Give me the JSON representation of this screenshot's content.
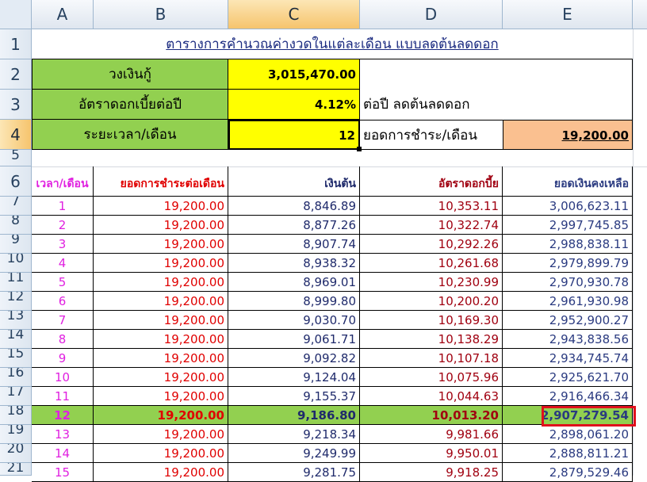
{
  "columns": [
    "A",
    "B",
    "C",
    "D",
    "E"
  ],
  "rows": [
    "1",
    "2",
    "3",
    "4",
    "5",
    "6",
    "7",
    "8",
    "9",
    "10",
    "11",
    "12",
    "13",
    "14",
    "15",
    "16",
    "17",
    "18",
    "19",
    "20",
    "21"
  ],
  "title": "ตารางการคำนวณค่างวดในแต่ละเดือน แบบลดต้นลดดอก",
  "loan_label": "วงเงินกู้",
  "loan_value": "3,015,470.00",
  "rate_label": "อัตราดอกเบี้ยต่อปี",
  "rate_value": "4.12%",
  "rate_note": "ต่อปี ลดต้นลดดอก",
  "term_label": "ระยะเวลา/เดือน",
  "term_value": "12",
  "payment_label": "ยอดการชำระ/เดือน",
  "payment_value": "19,200.00",
  "table": {
    "headers": [
      "เวลา/เดือน",
      "ยอดการชำระต่อเดือน",
      "เงินต้น",
      "อัตราดอกบี้ย",
      "ยอดเงินคงเหลือ"
    ],
    "rows": [
      [
        "1",
        "19,200.00",
        "8,846.89",
        "10,353.11",
        "3,006,623.11"
      ],
      [
        "2",
        "19,200.00",
        "8,877.26",
        "10,322.74",
        "2,997,745.85"
      ],
      [
        "3",
        "19,200.00",
        "8,907.74",
        "10,292.26",
        "2,988,838.11"
      ],
      [
        "4",
        "19,200.00",
        "8,938.32",
        "10,261.68",
        "2,979,899.79"
      ],
      [
        "5",
        "19,200.00",
        "8,969.01",
        "10,230.99",
        "2,970,930.78"
      ],
      [
        "6",
        "19,200.00",
        "8,999.80",
        "10,200.20",
        "2,961,930.98"
      ],
      [
        "7",
        "19,200.00",
        "9,030.70",
        "10,169.30",
        "2,952,900.27"
      ],
      [
        "8",
        "19,200.00",
        "9,061.71",
        "10,138.29",
        "2,943,838.56"
      ],
      [
        "9",
        "19,200.00",
        "9,092.82",
        "10,107.18",
        "2,934,745.74"
      ],
      [
        "10",
        "19,200.00",
        "9,124.04",
        "10,075.96",
        "2,925,621.70"
      ],
      [
        "11",
        "19,200.00",
        "9,155.37",
        "10,044.63",
        "2,916,466.34"
      ],
      [
        "12",
        "19,200.00",
        "9,186.80",
        "10,013.20",
        "2,907,279.54"
      ],
      [
        "13",
        "19,200.00",
        "9,218.34",
        "9,981.66",
        "2,898,061.20"
      ],
      [
        "14",
        "19,200.00",
        "9,249.99",
        "9,950.01",
        "2,888,811.21"
      ],
      [
        "15",
        "19,200.00",
        "9,281.75",
        "9,918.25",
        "2,879,529.46"
      ]
    ]
  },
  "colors": {
    "green": "#92d050",
    "yellow": "#ffff00",
    "peach": "#fac090",
    "month": "#e020e0",
    "payment": "#e00000",
    "principal": "#1f2a6b",
    "interest": "#a00010",
    "balance": "#2a3a80",
    "highlight_border": "#e0101c"
  },
  "selected_cell": "C4",
  "highlighted_row": "12",
  "highlighted_balance": "2,907,279.54"
}
